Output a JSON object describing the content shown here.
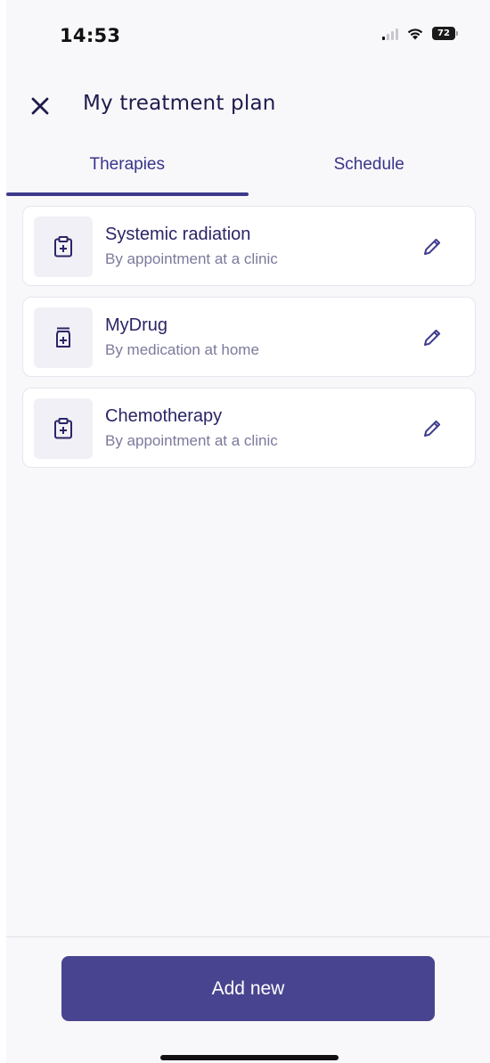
{
  "status_bar": {
    "time": "14:53",
    "battery_level": "72",
    "icons": [
      "signal-icon",
      "wifi-icon",
      "battery-icon"
    ]
  },
  "header": {
    "title": "My treatment plan",
    "close_icon": "close-icon"
  },
  "tabs": [
    {
      "label": "Therapies",
      "active": true
    },
    {
      "label": "Schedule",
      "active": false
    }
  ],
  "therapies": [
    {
      "title": "Systemic radiation",
      "subtitle": "By appointment at a clinic",
      "icon": "clipboard-plus-icon"
    },
    {
      "title": "MyDrug",
      "subtitle": "By medication at home",
      "icon": "medicine-bottle-icon"
    },
    {
      "title": "Chemotherapy",
      "subtitle": "By appointment at a clinic",
      "icon": "clipboard-plus-icon"
    }
  ],
  "footer": {
    "add_label": "Add new"
  },
  "colors": {
    "accent": "#49448f",
    "text_primary": "#2a2566",
    "text_secondary": "#7b7a9c",
    "background": "#f8f7fa"
  }
}
